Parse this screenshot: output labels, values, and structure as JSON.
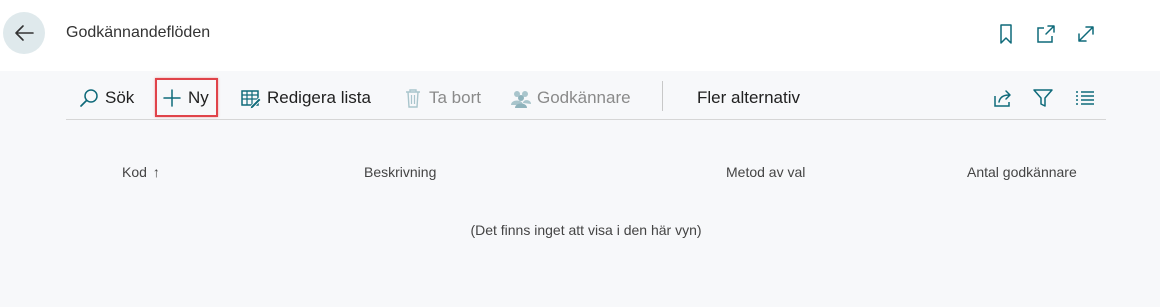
{
  "header": {
    "title": "Godkännandeflöden",
    "back_icon": "arrow-left-icon",
    "right_icons": [
      "bookmark-icon",
      "open-in-new-window-icon",
      "expand-icon"
    ]
  },
  "toolbar": {
    "search_label": "Sök",
    "new_label": "Ny",
    "edit_list_label": "Redigera lista",
    "delete_label": "Ta bort",
    "approvers_label": "Godkännare",
    "more_options_label": "Fler alternativ",
    "right_icons": [
      "share-icon",
      "filter-icon",
      "list-view-icon"
    ]
  },
  "table": {
    "columns": [
      "Kod",
      "Beskrivning",
      "Metod av val",
      "Antal godkännare"
    ],
    "sort_indicator": "↑",
    "empty_message": "(Det finns inget att visa i den här vyn)"
  },
  "colors": {
    "accent": "#0f6a7a",
    "highlight_border": "#e0434a",
    "back_button_bg": "#dfe9ec",
    "page_bg": "#f7f8fa"
  }
}
